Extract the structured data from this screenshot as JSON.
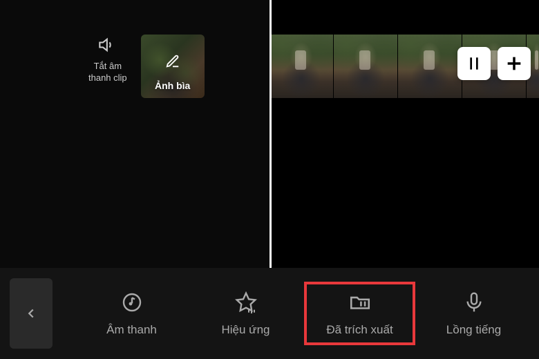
{
  "leftPanel": {
    "muteLabel": "Tắt âm\nthanh clip",
    "coverLabel": "Ảnh bìa"
  },
  "toolbar": {
    "items": [
      {
        "label": "Âm thanh"
      },
      {
        "label": "Hiệu ứng"
      },
      {
        "label": "Đã trích xuất"
      },
      {
        "label": "Lồng tiếng"
      }
    ]
  }
}
